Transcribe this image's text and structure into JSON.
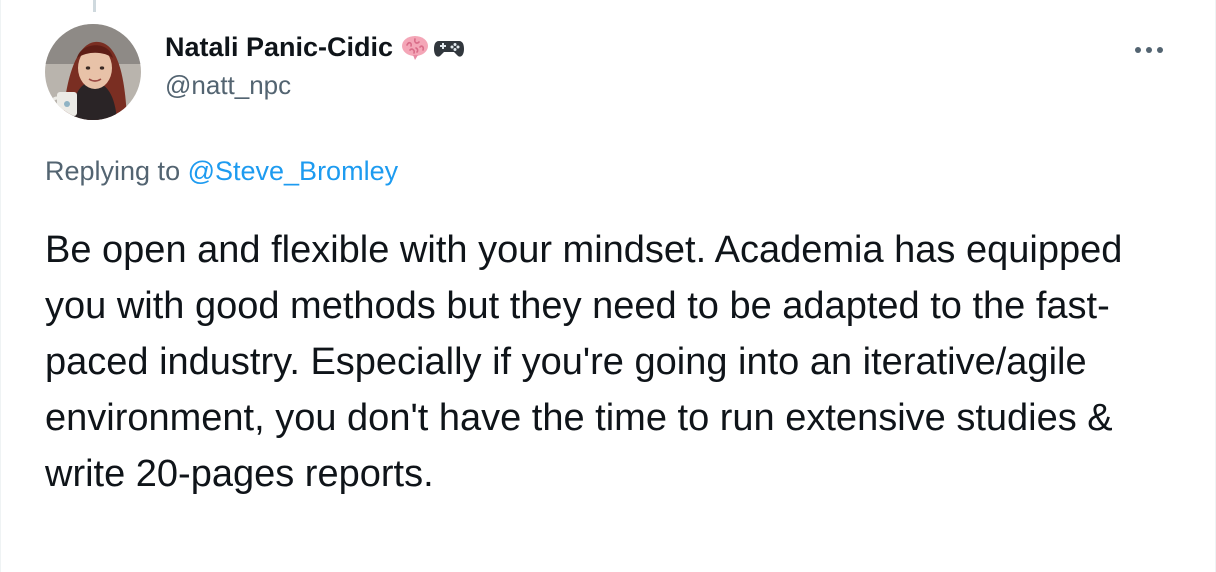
{
  "tweet": {
    "author": {
      "display_name": "Natali Panic-Cidic",
      "handle": "@natt_npc",
      "name_emojis": [
        "brain-emoji",
        "game-controller-emoji"
      ],
      "avatar_icon": "profile-photo"
    },
    "more_icon": "more-horizontal-icon",
    "replying_prefix": "Replying to ",
    "replying_to": "@Steve_Bromley",
    "text": "Be open and flexible with your mindset. Academia has equipped you with good methods but they need to be adapted to the fast-paced industry. Especially if you're going into an iterative/agile environment, you don't have the time to run extensive studies & write 20-pages reports."
  },
  "colors": {
    "text_primary": "#0f1419",
    "text_secondary": "#536471",
    "link_blue": "#1d9bf0",
    "border": "#eff3f4"
  }
}
